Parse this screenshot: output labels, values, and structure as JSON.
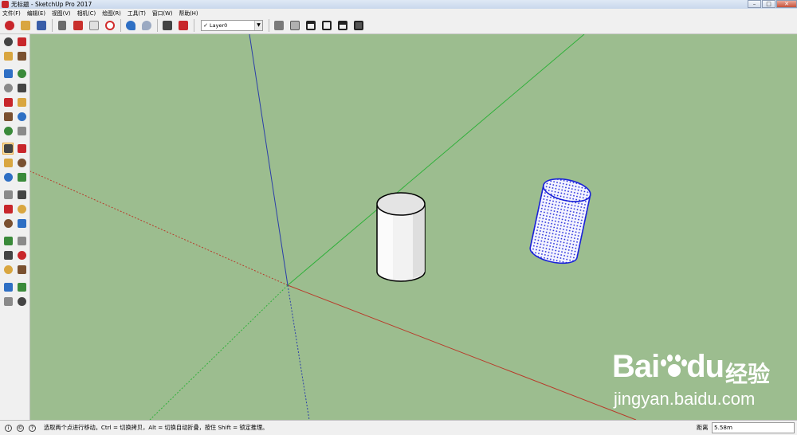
{
  "window": {
    "title": "无标题 - SketchUp Pro 2017",
    "controls": [
      "minimize-icon",
      "maximize-icon",
      "close-icon"
    ]
  },
  "menubar": {
    "items": [
      {
        "label": "文件(F)"
      },
      {
        "label": "编辑(E)"
      },
      {
        "label": "视图(V)"
      },
      {
        "label": "相机(C)"
      },
      {
        "label": "绘图(R)"
      },
      {
        "label": "工具(T)"
      },
      {
        "label": "窗口(W)"
      },
      {
        "label": "帮助(H)"
      }
    ]
  },
  "toolbar": {
    "buttons": [
      "new-icon",
      "open-icon",
      "save-icon",
      "cut-icon",
      "copy-icon",
      "paste-icon",
      "erase-icon",
      "undo-icon",
      "redo-icon",
      "print-icon",
      "model-info-icon"
    ],
    "layer": {
      "check": "✓",
      "value": "Layer0"
    },
    "view_buttons": [
      "iso-view-icon",
      "top-view-icon",
      "front-view-icon",
      "right-view-icon",
      "back-view-icon",
      "left-view-icon"
    ]
  },
  "palette": {
    "tools": [
      [
        "select-icon",
        "make-component-icon"
      ],
      [
        "paint-bucket-icon",
        "eraser-icon"
      ],
      [
        "line-icon",
        "freehand-icon"
      ],
      [
        "rectangle-icon",
        "rotated-rectangle-icon"
      ],
      [
        "circle-icon",
        "polygon-icon"
      ],
      [
        "arc-icon",
        "two-point-arc-icon"
      ],
      [
        "three-point-arc-icon",
        "pie-icon"
      ],
      [
        "move-icon",
        "push-pull-icon"
      ],
      [
        "rotate-icon",
        "follow-me-icon"
      ],
      [
        "scale-icon",
        "offset-icon"
      ],
      [
        "tape-measure-icon",
        "dimension-icon"
      ],
      [
        "protractor-icon",
        "text-icon"
      ],
      [
        "axes-icon",
        "3d-text-icon"
      ],
      [
        "orbit-icon",
        "pan-icon"
      ],
      [
        "zoom-icon",
        "zoom-window-icon"
      ],
      [
        "zoom-extents-icon",
        "previous-view-icon"
      ],
      [
        "position-camera-icon",
        "look-around-icon"
      ],
      [
        "walk-icon",
        "section-plane-icon"
      ]
    ],
    "active": "move-icon"
  },
  "watermark": {
    "brand": "Bai",
    "brand_tail": "du",
    "brand_cn": "经验",
    "url": "jingyan.baidu.com"
  },
  "statusbar": {
    "message": "选取两个点进行移动。Ctrl = 切换拷贝，Alt = 切换自动折叠，按住 Shift = 锁定推理。",
    "measure_label": "距离",
    "measure_value": "5.58m"
  },
  "colors": {
    "viewport_bg": "#9cbd8f",
    "axis_red": "#b83a2a",
    "axis_green": "#2fb03a",
    "axis_blue": "#2b3fa8",
    "selection_blue": "#1a22d8"
  }
}
